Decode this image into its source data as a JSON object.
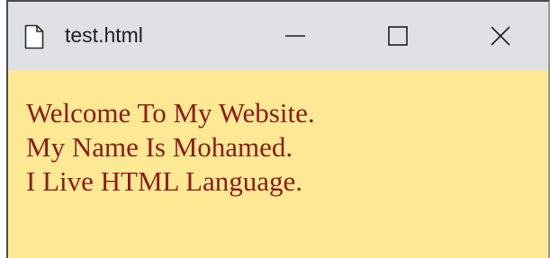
{
  "window": {
    "title": "test.html",
    "icons": {
      "page": "page-icon",
      "minimize": "minimize-icon",
      "maximize": "maximize-icon",
      "close": "close-icon"
    }
  },
  "content": {
    "lines": [
      "Welcome To My Website.",
      "My Name Is Mohamed.",
      "I Live HTML Language."
    ]
  },
  "colors": {
    "page_background": "#fde993",
    "text": "#8b1b1b",
    "titlebar": "#dfe1e5"
  }
}
